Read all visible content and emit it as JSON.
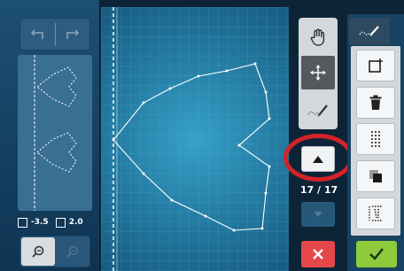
{
  "toolbar": {
    "undo_icon": "undo-icon",
    "redo_icon": "redo-icon"
  },
  "position": {
    "x_value": "-3.5",
    "y_value": "2.0"
  },
  "zoom": {
    "zoom_in_icon": "zoom-in-icon",
    "zoom_out_icon": "zoom-out-icon"
  },
  "tools": {
    "hand": "hand-icon",
    "move": "move-arrows-icon",
    "stitch": "stitch-edit-icon"
  },
  "navigation": {
    "counter": "17 / 17"
  },
  "right_panel": {
    "tab_icon": "stitch-edit-icon",
    "buttons": [
      "insert-point-icon",
      "delete-icon",
      "triple-stitch-icon",
      "duplicate-icon",
      "split-stitch-icon"
    ]
  },
  "colors": {
    "accent_red": "#d3222a",
    "ok_green": "#8ecb3c",
    "cancel_red": "#e4474a",
    "canvas_blue": "#2b8bb3"
  }
}
